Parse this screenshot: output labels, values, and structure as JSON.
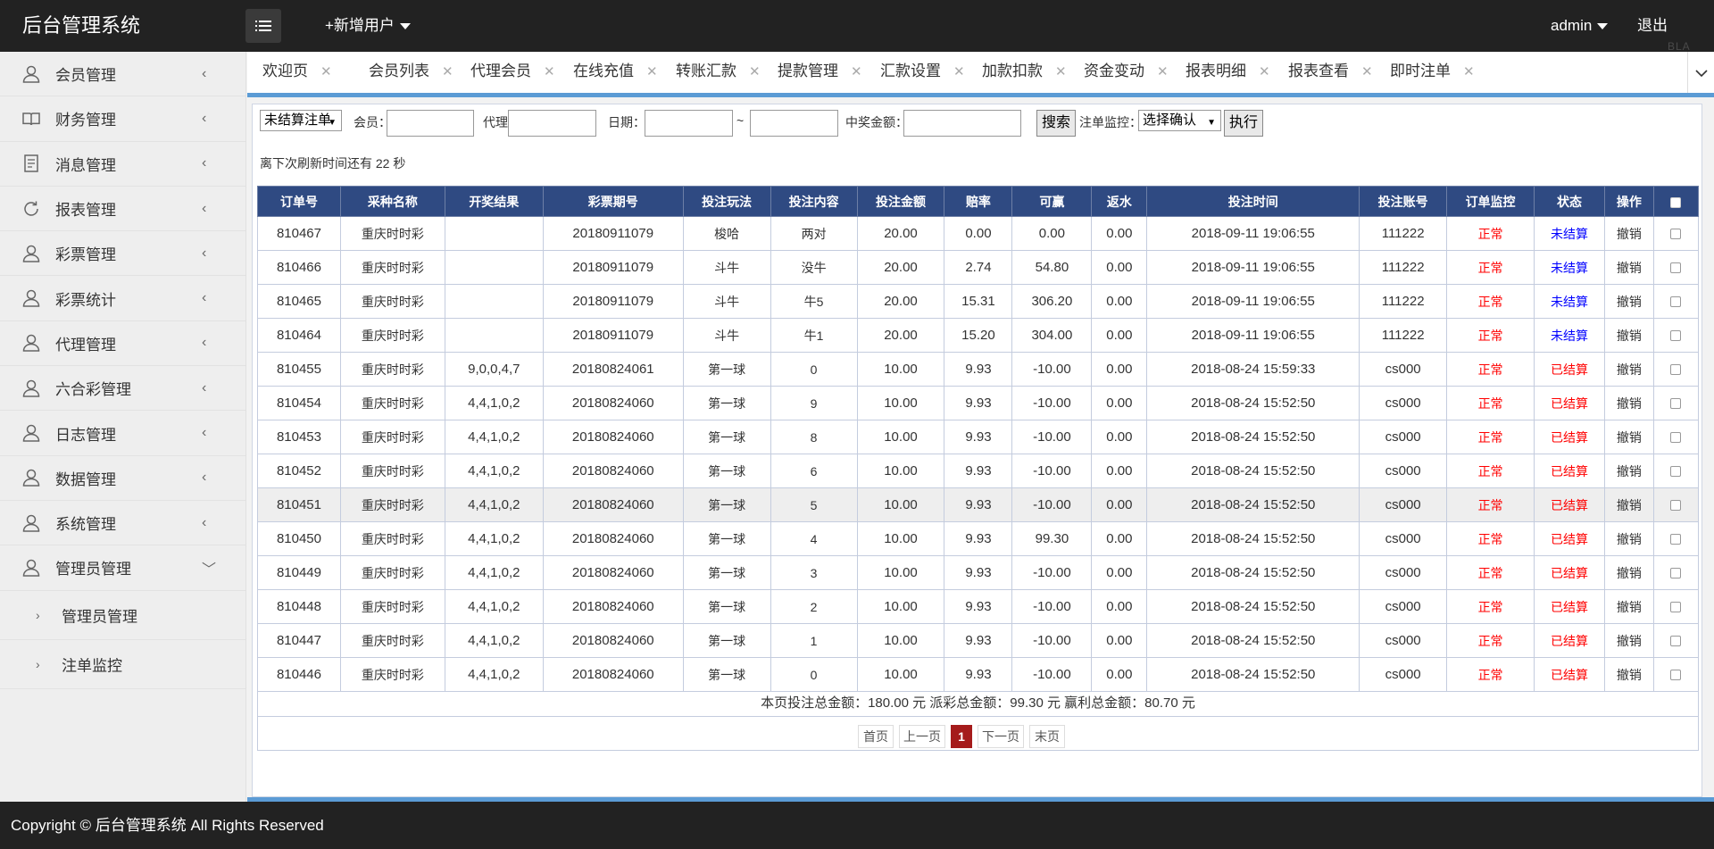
{
  "app": {
    "title": "后台管理系统",
    "add_user": "+新增用户",
    "admin": "admin",
    "logout": "退出",
    "watermark": "BLA"
  },
  "sidebar": {
    "items": [
      {
        "label": "会员管理",
        "icon": "user-icon",
        "arrow": "‹"
      },
      {
        "label": "财务管理",
        "icon": "book-icon",
        "arrow": "‹"
      },
      {
        "label": "消息管理",
        "icon": "doc-icon",
        "arrow": "‹"
      },
      {
        "label": "报表管理",
        "icon": "refresh-icon",
        "arrow": "‹"
      },
      {
        "label": "彩票管理",
        "icon": "user-icon",
        "arrow": "‹"
      },
      {
        "label": "彩票统计",
        "icon": "user-icon",
        "arrow": "‹"
      },
      {
        "label": "代理管理",
        "icon": "user-icon",
        "arrow": "‹"
      },
      {
        "label": "六合彩管理",
        "icon": "user-icon",
        "arrow": "‹"
      },
      {
        "label": "日志管理",
        "icon": "user-icon",
        "arrow": "‹"
      },
      {
        "label": "数据管理",
        "icon": "user-icon",
        "arrow": "‹"
      },
      {
        "label": "系统管理",
        "icon": "user-icon",
        "arrow": "‹"
      },
      {
        "label": "管理员管理",
        "icon": "user-icon",
        "arrow": "﹀"
      }
    ],
    "sub_items": [
      {
        "label": "管理员管理",
        "arrow": "›"
      },
      {
        "label": "注单监控",
        "arrow": "›"
      }
    ]
  },
  "tabs": [
    {
      "label": "欢迎页"
    },
    {
      "label": "会员列表"
    },
    {
      "label": "代理会员"
    },
    {
      "label": "在线充值"
    },
    {
      "label": "转账汇款"
    },
    {
      "label": "提款管理"
    },
    {
      "label": "汇款设置"
    },
    {
      "label": "加款扣款"
    },
    {
      "label": "资金变动"
    },
    {
      "label": "报表明细"
    },
    {
      "label": "报表查看"
    },
    {
      "label": "即时注单"
    }
  ],
  "tab_close": "✕",
  "filter": {
    "status_select": "未结算注单",
    "member_label": "会员：",
    "agent_label": "代理",
    "date_label": "日期：",
    "date_sep": "~",
    "win_label": "中奖金额：",
    "search_btn": "搜索",
    "monitor_label": "注单监控：",
    "monitor_select": "选择确认",
    "exec_btn": "执行",
    "refresh_note": "离下次刷新时间还有 22 秒"
  },
  "table": {
    "headers": [
      "订单号",
      "采种名称",
      "开奖结果",
      "彩票期号",
      "投注玩法",
      "投注内容",
      "投注金额",
      "赔率",
      "可赢",
      "返水",
      "投注时间",
      "投注账号",
      "订单监控",
      "状态",
      "操作"
    ],
    "rows": [
      [
        "810467",
        "重庆时时彩",
        "",
        "20180911079",
        "梭哈",
        "两对",
        "20.00",
        "0.00",
        "0.00",
        "0.00",
        "2018-09-11 19:06:55",
        "111222",
        "正常",
        "未结算",
        "撤销"
      ],
      [
        "810466",
        "重庆时时彩",
        "",
        "20180911079",
        "斗牛",
        "没牛",
        "20.00",
        "2.74",
        "54.80",
        "0.00",
        "2018-09-11 19:06:55",
        "111222",
        "正常",
        "未结算",
        "撤销"
      ],
      [
        "810465",
        "重庆时时彩",
        "",
        "20180911079",
        "斗牛",
        "牛5",
        "20.00",
        "15.31",
        "306.20",
        "0.00",
        "2018-09-11 19:06:55",
        "111222",
        "正常",
        "未结算",
        "撤销"
      ],
      [
        "810464",
        "重庆时时彩",
        "",
        "20180911079",
        "斗牛",
        "牛1",
        "20.00",
        "15.20",
        "304.00",
        "0.00",
        "2018-09-11 19:06:55",
        "111222",
        "正常",
        "未结算",
        "撤销"
      ],
      [
        "810455",
        "重庆时时彩",
        "9,0,0,4,7",
        "20180824061",
        "第一球",
        "0",
        "10.00",
        "9.93",
        "-10.00",
        "0.00",
        "2018-08-24 15:59:33",
        "cs000",
        "正常",
        "已结算",
        "撤销"
      ],
      [
        "810454",
        "重庆时时彩",
        "4,4,1,0,2",
        "20180824060",
        "第一球",
        "9",
        "10.00",
        "9.93",
        "-10.00",
        "0.00",
        "2018-08-24 15:52:50",
        "cs000",
        "正常",
        "已结算",
        "撤销"
      ],
      [
        "810453",
        "重庆时时彩",
        "4,4,1,0,2",
        "20180824060",
        "第一球",
        "8",
        "10.00",
        "9.93",
        "-10.00",
        "0.00",
        "2018-08-24 15:52:50",
        "cs000",
        "正常",
        "已结算",
        "撤销"
      ],
      [
        "810452",
        "重庆时时彩",
        "4,4,1,0,2",
        "20180824060",
        "第一球",
        "6",
        "10.00",
        "9.93",
        "-10.00",
        "0.00",
        "2018-08-24 15:52:50",
        "cs000",
        "正常",
        "已结算",
        "撤销"
      ],
      [
        "810451",
        "重庆时时彩",
        "4,4,1,0,2",
        "20180824060",
        "第一球",
        "5",
        "10.00",
        "9.93",
        "-10.00",
        "0.00",
        "2018-08-24 15:52:50",
        "cs000",
        "正常",
        "已结算",
        "撤销"
      ],
      [
        "810450",
        "重庆时时彩",
        "4,4,1,0,2",
        "20180824060",
        "第一球",
        "4",
        "10.00",
        "9.93",
        "99.30",
        "0.00",
        "2018-08-24 15:52:50",
        "cs000",
        "正常",
        "已结算",
        "撤销"
      ],
      [
        "810449",
        "重庆时时彩",
        "4,4,1,0,2",
        "20180824060",
        "第一球",
        "3",
        "10.00",
        "9.93",
        "-10.00",
        "0.00",
        "2018-08-24 15:52:50",
        "cs000",
        "正常",
        "已结算",
        "撤销"
      ],
      [
        "810448",
        "重庆时时彩",
        "4,4,1,0,2",
        "20180824060",
        "第一球",
        "2",
        "10.00",
        "9.93",
        "-10.00",
        "0.00",
        "2018-08-24 15:52:50",
        "cs000",
        "正常",
        "已结算",
        "撤销"
      ],
      [
        "810447",
        "重庆时时彩",
        "4,4,1,0,2",
        "20180824060",
        "第一球",
        "1",
        "10.00",
        "9.93",
        "-10.00",
        "0.00",
        "2018-08-24 15:52:50",
        "cs000",
        "正常",
        "已结算",
        "撤销"
      ],
      [
        "810446",
        "重庆时时彩",
        "4,4,1,0,2",
        "20180824060",
        "第一球",
        "0",
        "10.00",
        "9.93",
        "-10.00",
        "0.00",
        "2018-08-24 15:52:50",
        "cs000",
        "正常",
        "已结算",
        "撤销"
      ]
    ],
    "highlight_row": 8,
    "summary": "本页投注总金额：180.00 元  派彩总金额：99.30 元  赢利总金额：80.70 元"
  },
  "pager": {
    "first": "首页",
    "prev": "上一页",
    "current": "1",
    "next": "下一页",
    "last": "末页"
  },
  "footer": {
    "copyright": "Copyright © 后台管理系统 All Rights Reserved"
  },
  "colors": {
    "header_bg": "#222222",
    "table_header": "#2f4a82",
    "status_red": "#ff0000",
    "status_blue": "#0000ff",
    "pager_current": "#a51b1b",
    "accent": "#5b9bd5"
  }
}
